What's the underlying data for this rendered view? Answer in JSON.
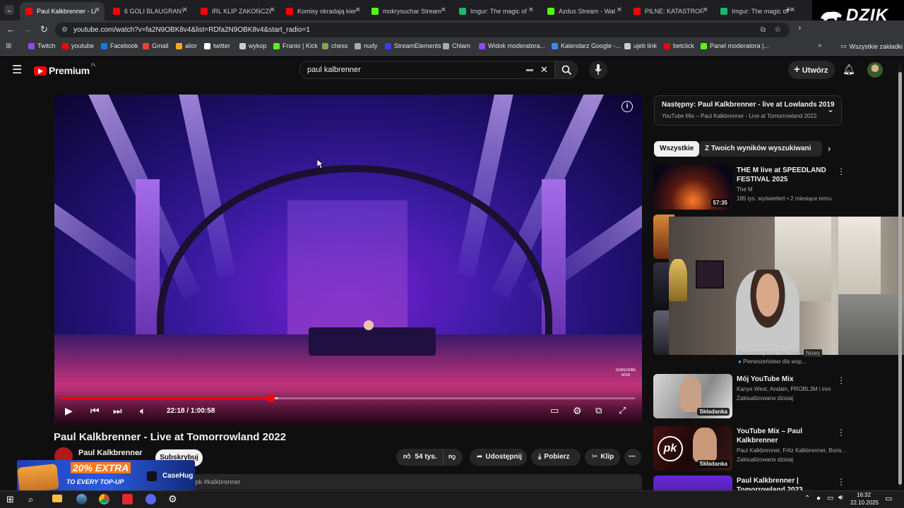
{
  "browser": {
    "tabs": [
      {
        "label": "Paul Kalkbrenner - Li",
        "color": "#ff0000",
        "active": true
      },
      {
        "label": "6 GOLI BLAUGRANY!",
        "color": "#ff0000"
      },
      {
        "label": "IRL KLIP ZAKOŃCZO",
        "color": "#ff0000"
      },
      {
        "label": "Komisy okradają kier",
        "color": "#ff0000"
      },
      {
        "label": "mokrysuchar Stream",
        "color": "#53fc18"
      },
      {
        "label": "Imgur: The magic of",
        "color": "#1bb76e"
      },
      {
        "label": "Azdus Stream - Wat",
        "color": "#53fc18"
      },
      {
        "label": "PILNE: KATASTROFA",
        "color": "#ff0000"
      },
      {
        "label": "Imgur: The magic of",
        "color": "#1bb76e"
      }
    ],
    "url": "youtube.com/watch?v=fa2N9OBK8v4&list=RDfa2N9OBK8v4&start_radio=1",
    "bookmarks": [
      {
        "label": "Twitch",
        "color": "#9146ff"
      },
      {
        "label": "youtube",
        "color": "#ff0000"
      },
      {
        "label": "Facebook",
        "color": "#1877f2"
      },
      {
        "label": "Gmail",
        "color": "#ea4335"
      },
      {
        "label": "alior",
        "color": "#f5a623"
      },
      {
        "label": "twitter",
        "color": "#ffffff"
      },
      {
        "label": "wykop",
        "color": "#cccccc"
      },
      {
        "label": "Franio | Kick",
        "color": "#53fc18"
      },
      {
        "label": "chess",
        "color": "#7fa650"
      },
      {
        "label": "nudy",
        "color": "#aaaaaa"
      },
      {
        "label": "StreamElements",
        "color": "#3b3bff"
      },
      {
        "label": "Chłam",
        "color": "#aaaaaa"
      },
      {
        "label": "Widok moderatora...",
        "color": "#9146ff"
      },
      {
        "label": "Kalendarz Google -...",
        "color": "#4285f4"
      },
      {
        "label": "ujeb link",
        "color": "#cccccc"
      },
      {
        "label": "betclick",
        "color": "#e30613"
      },
      {
        "label": "Panel moderatora |...",
        "color": "#53fc18"
      }
    ],
    "all_bookmarks": "Wszystkie zakładki"
  },
  "overlay_logo": "DZIK",
  "youtube": {
    "logo": "Premium",
    "logo_region": "PL",
    "search_value": "paul kalbrenner",
    "create_label": "Utwórz"
  },
  "player": {
    "time": "22:18 / 1:00:58",
    "progress_fraction": 0.3645,
    "buffer_fraction": 0.378,
    "watermark": "SUBSCRIBE NOW"
  },
  "video": {
    "title": "Paul Kalkbrenner - Live at Tomorrowland 2022",
    "channel": "Paul Kalkbrenner",
    "subscribe_label": "Subskrybuj",
    "likes": "54 tys.",
    "share_label": "Udostępnij",
    "download_label": "Pobierz",
    "clip_label": "Klip",
    "hashtags": "nd #pk #kalkbrenner"
  },
  "sidebar": {
    "upnext_title": "Następny: Paul Kalkbrenner - live at Lowlands 2019",
    "upnext_sub": "YouTube Mix – Paul Kalkbrenner - Live at Tomorrowland 2022",
    "chips": [
      "Wszystkie",
      "Z Twoich wyników wyszukiwania"
    ],
    "items": [
      {
        "title": "THE M live at SPEEDLAND FESTIVAL 2025",
        "channel": "The M",
        "meta": "185 tys. wyświetleń • 2 miesiące temu",
        "duration": "57:35"
      },
      {
        "title": "Mój YouTube Mix",
        "channel": "Kanye West, Andain, PROBL3M i inni",
        "meta": "Zaktualizowano dzisiaj",
        "duration": "Składanka"
      },
      {
        "title": "YouTube Mix – Paul Kalkbrenner",
        "channel": "Paul Kalkbrenner, Fritz Kalkbrenner, Boris...",
        "meta": "Zaktualizowano dzisiaj",
        "duration": "Składanka"
      },
      {
        "title": "Paul Kalkbrenner | Tomorrowland 2023",
        "channel": "",
        "meta": "",
        "duration": ""
      }
    ],
    "hidden_item_meta": "Polecane przez YouTube",
    "hidden_item_badge": "Nowy",
    "hidden_item_promo": "Pierwszeństwo dla wsp..."
  },
  "ad": {
    "line1": "20% EXTRA",
    "line2": "TO EVERY TOP-UP",
    "brand": "CaseHug"
  },
  "taskbar": {
    "time": "16:32",
    "date": "22.10.2025"
  }
}
